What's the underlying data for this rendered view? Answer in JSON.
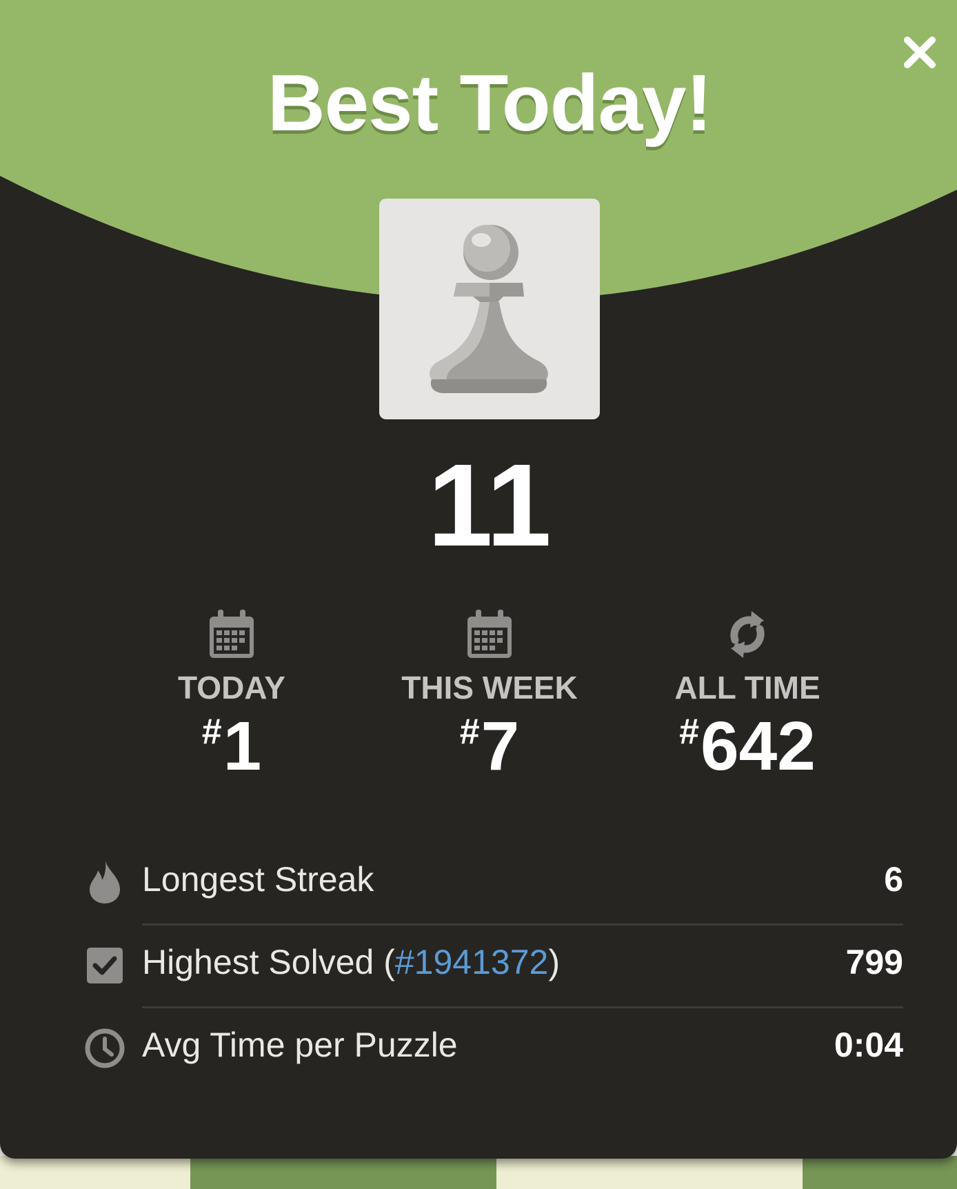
{
  "modal": {
    "title": "Best Today!",
    "score": "11",
    "colors": {
      "header_green": "#95b868",
      "panel": "#262522",
      "link": "#5b9bd5"
    },
    "avatar_icon": "pawn-icon"
  },
  "ranks": [
    {
      "icon": "calendar-icon",
      "label": "TODAY",
      "hash": "#",
      "value": "1"
    },
    {
      "icon": "calendar-icon",
      "label": "THIS WEEK",
      "hash": "#",
      "value": "7"
    },
    {
      "icon": "refresh-icon",
      "label": "ALL TIME",
      "hash": "#",
      "value": "642"
    }
  ],
  "stats": {
    "longest_streak": {
      "icon": "flame-icon",
      "label": "Longest Streak",
      "value": "6"
    },
    "highest_solved": {
      "icon": "checkbox-icon",
      "label_prefix": "Highest Solved (",
      "link": "#1941372",
      "label_suffix": ")",
      "value": "799"
    },
    "avg_time": {
      "icon": "clock-icon",
      "label": "Avg Time per Puzzle",
      "value": "0:04"
    }
  }
}
